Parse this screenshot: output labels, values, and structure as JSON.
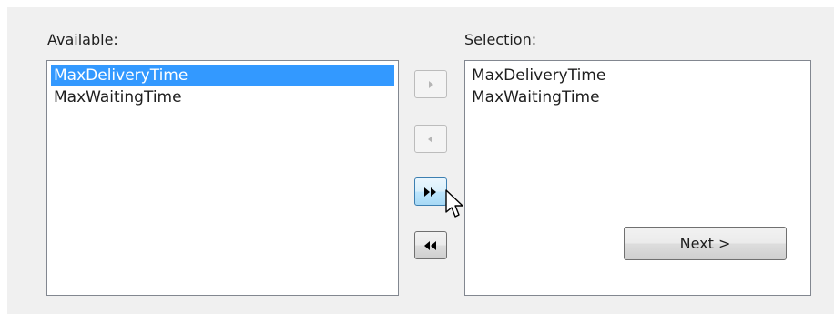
{
  "dialog": {
    "available_label": "Available:",
    "selection_label": "Selection:"
  },
  "available_list": {
    "items": [
      {
        "label": "MaxDeliveryTime",
        "selected": true
      },
      {
        "label": "MaxWaitingTime",
        "selected": false
      }
    ]
  },
  "selection_list": {
    "items": [
      {
        "label": "MaxDeliveryTime"
      },
      {
        "label": "MaxWaitingTime"
      }
    ]
  },
  "move_buttons": {
    "add_one": {
      "icon": "arrow-right-icon",
      "enabled": false
    },
    "remove_one": {
      "icon": "arrow-left-icon",
      "enabled": false
    },
    "add_all": {
      "icon": "double-arrow-right-icon",
      "enabled": true,
      "hovered": true
    },
    "remove_all": {
      "icon": "double-arrow-left-icon",
      "enabled": true
    }
  },
  "next_button": {
    "label": "Next >"
  },
  "cursor": {
    "icon": "mouse-pointer-icon"
  },
  "colors": {
    "selection_highlight": "#3399ff",
    "dialog_background": "#f0f0f0",
    "border": "#828790"
  }
}
